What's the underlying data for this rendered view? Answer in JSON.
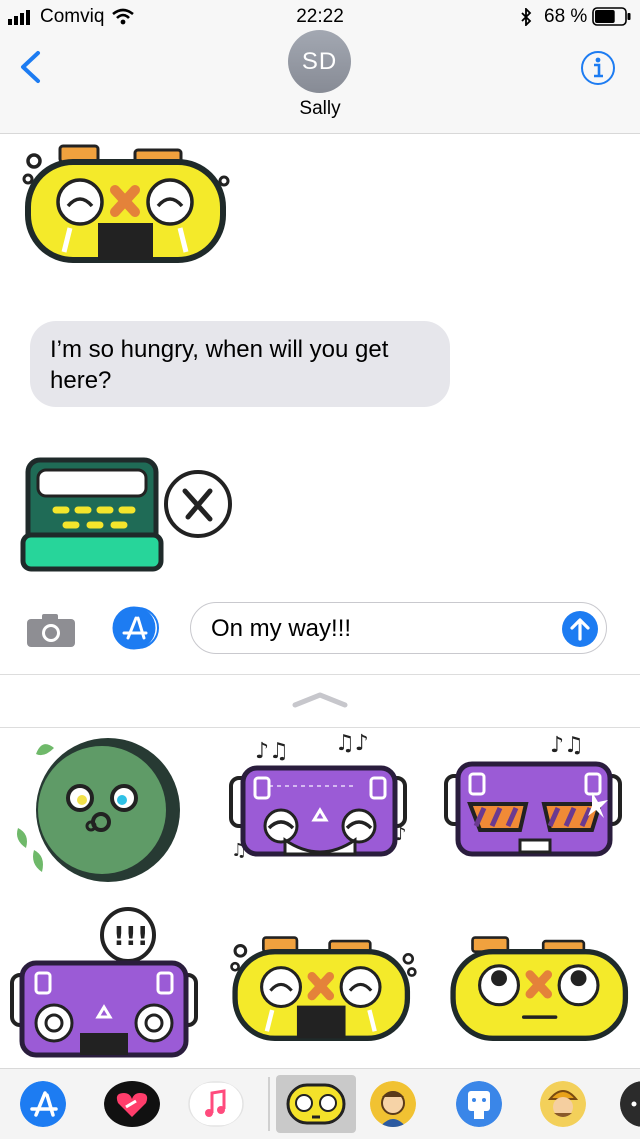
{
  "status_bar": {
    "carrier": "Comviq",
    "time": "22:22",
    "battery_percent": "68 %",
    "battery_level": 0.68
  },
  "header": {
    "avatar_initials": "SD",
    "contact_name": "Sally"
  },
  "messages": [
    {
      "type": "sticker",
      "name": "yellow-boombox-crying-sticker"
    },
    {
      "type": "text",
      "text": "I’m so hungry, when will you get here?"
    },
    {
      "type": "sticker",
      "name": "green-boombox-hungry-sticker"
    }
  ],
  "composer": {
    "input_value": "On my way!!!"
  },
  "sticker_drawer": {
    "stickers": [
      "green-speaker-sticker",
      "purple-boombox-music-sticker",
      "purple-boombox-sunglasses-sticker",
      "purple-boombox-shouting-sticker",
      "yellow-boombox-crying-sticker",
      "yellow-boombox-eyes-up-sticker"
    ]
  },
  "dock": {
    "apps": [
      "app-store-icon",
      "digital-touch-icon",
      "music-icon",
      "stickers-app-icon",
      "character-app-icon",
      "robot-app-icon",
      "miner-app-icon",
      "more-apps-icon"
    ]
  },
  "colors": {
    "accent": "#1d7cf2",
    "bubble_gray": "#e6e6eb",
    "header_bg": "#f7f7f7"
  }
}
